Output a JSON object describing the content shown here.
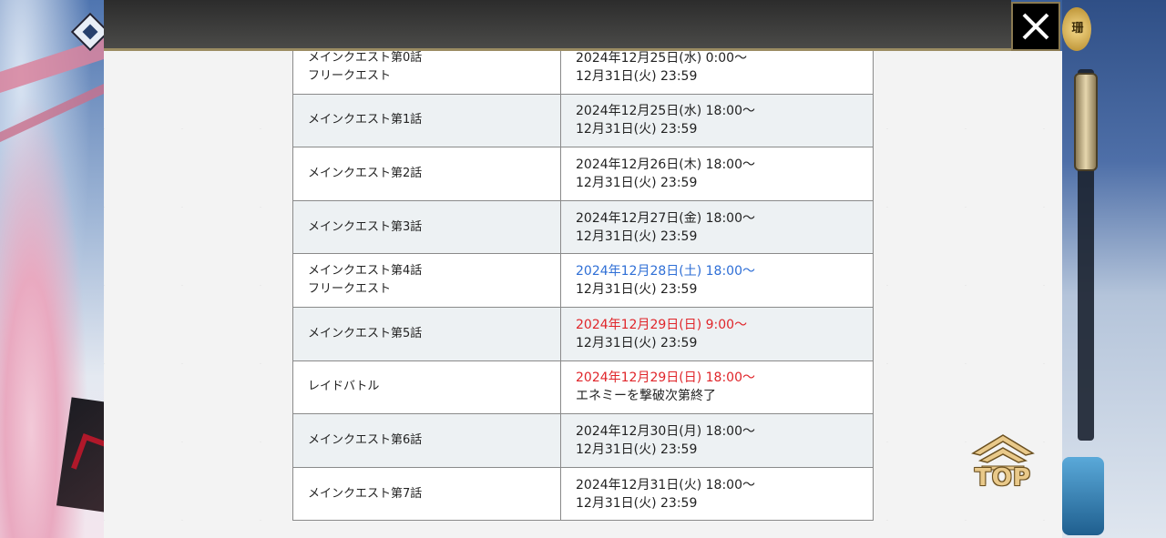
{
  "close": {
    "label": "✕"
  },
  "coin": {
    "label": "珊"
  },
  "schedule": {
    "rows": [
      {
        "quest": [
          "メインクエスト第0話",
          "フリークエスト"
        ],
        "time": [
          "2024年12月25日(水) 0:00～",
          "12月31日(火) 23:59"
        ],
        "start_color": "default"
      },
      {
        "quest": [
          "メインクエスト第1話"
        ],
        "time": [
          "2024年12月25日(水) 18:00～",
          "12月31日(火) 23:59"
        ],
        "start_color": "default"
      },
      {
        "quest": [
          "メインクエスト第2話"
        ],
        "time": [
          "2024年12月26日(木) 18:00～",
          "12月31日(火) 23:59"
        ],
        "start_color": "default"
      },
      {
        "quest": [
          "メインクエスト第3話"
        ],
        "time": [
          "2024年12月27日(金) 18:00～",
          "12月31日(火) 23:59"
        ],
        "start_color": "default"
      },
      {
        "quest": [
          "メインクエスト第4話",
          "フリークエスト"
        ],
        "time": [
          "2024年12月28日(土) 18:00～",
          "12月31日(火) 23:59"
        ],
        "start_color": "blue"
      },
      {
        "quest": [
          "メインクエスト第5話"
        ],
        "time": [
          "2024年12月29日(日) 9:00～",
          "12月31日(火) 23:59"
        ],
        "start_color": "red"
      },
      {
        "quest": [
          "レイドバトル"
        ],
        "time": [
          "2024年12月29日(日) 18:00～",
          "エネミーを撃破次第終了"
        ],
        "start_color": "red"
      },
      {
        "quest": [
          "メインクエスト第6話"
        ],
        "time": [
          "2024年12月30日(月) 18:00～",
          "12月31日(火) 23:59"
        ],
        "start_color": "default"
      },
      {
        "quest": [
          "メインクエスト第7話"
        ],
        "time": [
          "2024年12月31日(火) 18:00～",
          "12月31日(火) 23:59"
        ],
        "start_color": "default"
      }
    ]
  },
  "top_button": {
    "label": "TOP"
  },
  "colors": {
    "saturday": "#2f6fd6",
    "sunday": "#e0252a",
    "frame_gold": "#9b8c62"
  }
}
